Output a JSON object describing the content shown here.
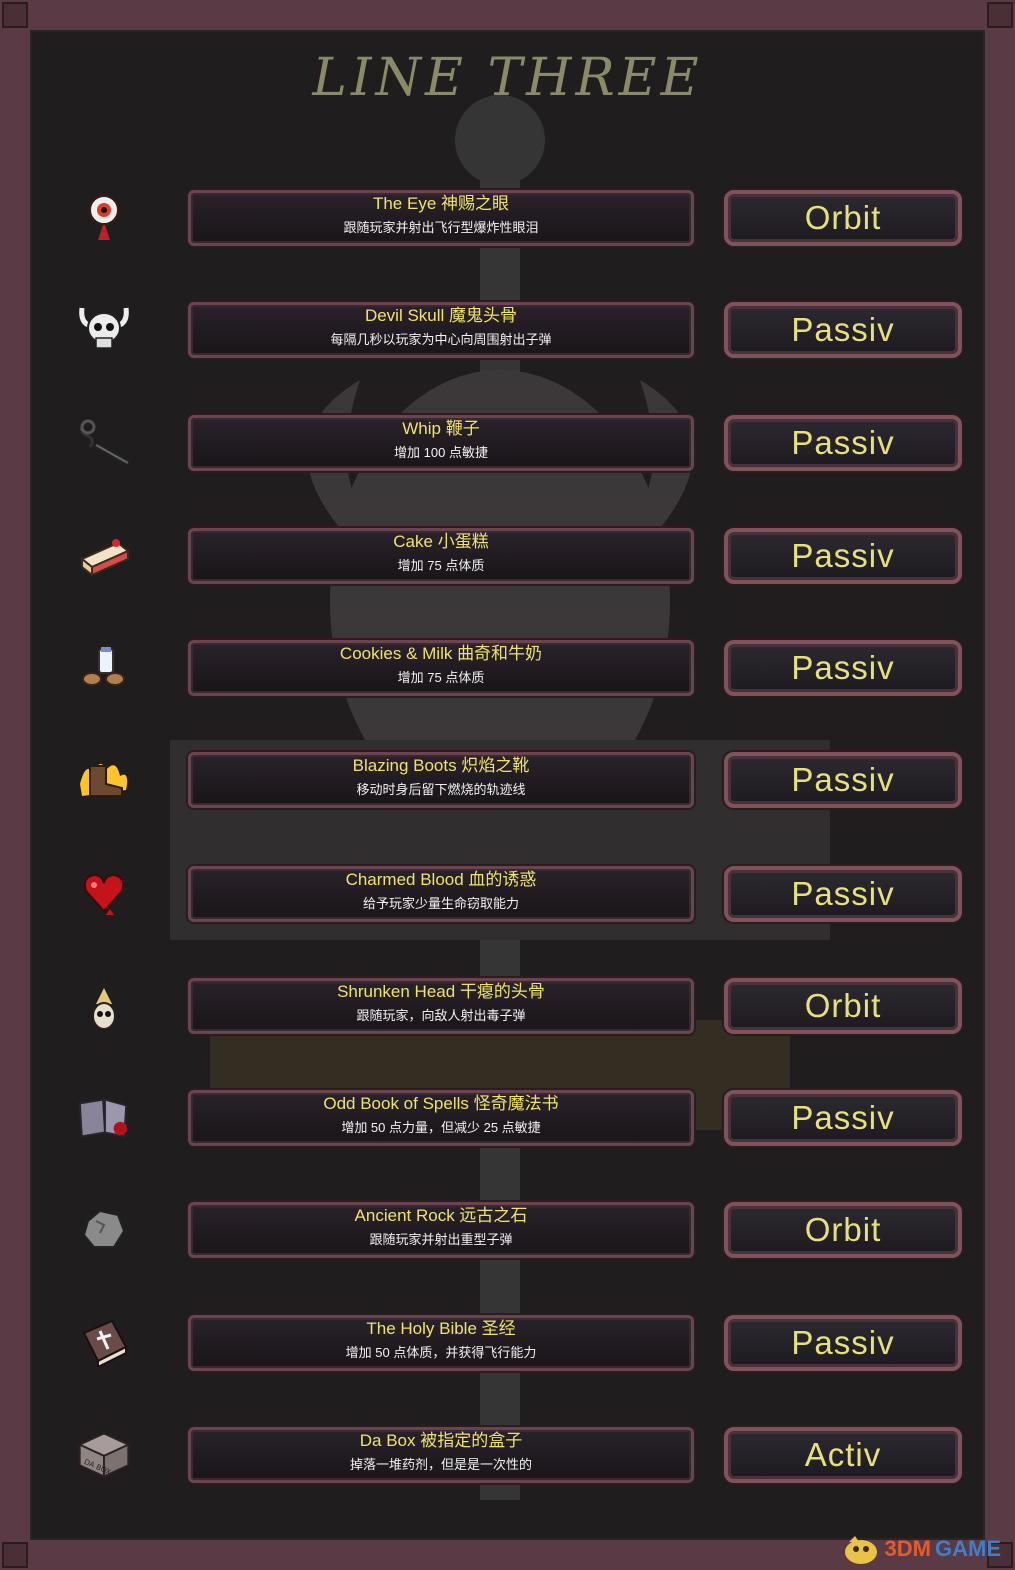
{
  "title": "LINE THREE",
  "items": [
    {
      "icon": "eye-icon",
      "name": "The Eye 神赐之眼",
      "effect": "跟随玩家并射出飞行型爆炸性眼泪",
      "type": "Orbit"
    },
    {
      "icon": "devil-skull-icon",
      "name": "Devil Skull 魔鬼头骨",
      "effect": "每隔几秒以玩家为中心向周围射出子弹",
      "type": "Passiv"
    },
    {
      "icon": "whip-icon",
      "name": "Whip 鞭子",
      "effect": "增加 100 点敏捷",
      "type": "Passiv"
    },
    {
      "icon": "cake-icon",
      "name": "Cake 小蛋糕",
      "effect": "增加 75 点体质",
      "type": "Passiv"
    },
    {
      "icon": "cookies-milk-icon",
      "name": "Cookies & Milk 曲奇和牛奶",
      "effect": "增加 75 点体质",
      "type": "Passiv"
    },
    {
      "icon": "blazing-boots-icon",
      "name": "Blazing Boots 炽焰之靴",
      "effect": "移动时身后留下燃烧的轨迹线",
      "type": "Passiv"
    },
    {
      "icon": "charmed-blood-icon",
      "name": "Charmed Blood 血的诱惑",
      "effect": "给予玩家少量生命窃取能力",
      "type": "Passiv"
    },
    {
      "icon": "shrunken-head-icon",
      "name": "Shrunken Head 干瘪的头骨",
      "effect": "跟随玩家，向敌人射出毒子弹",
      "type": "Orbit"
    },
    {
      "icon": "spell-book-icon",
      "name": "Odd Book of Spells 怪奇魔法书",
      "effect": "增加 50 点力量，但减少 25 点敏捷",
      "type": "Passiv"
    },
    {
      "icon": "rock-icon",
      "name": "Ancient Rock 远古之石",
      "effect": "跟随玩家并射出重型子弹",
      "type": "Orbit"
    },
    {
      "icon": "bible-icon",
      "name": "The Holy Bible 圣经",
      "effect": "增加 50 点体质，并获得飞行能力",
      "type": "Passiv"
    },
    {
      "icon": "box-icon",
      "name": "Da Box 被指定的盒子",
      "effect": "掉落一堆药剂，但是是一次性的",
      "type": "Activ"
    }
  ],
  "watermark": {
    "prefix": "3DM",
    "suffix": "GAME"
  },
  "box_label": "DA BOX"
}
